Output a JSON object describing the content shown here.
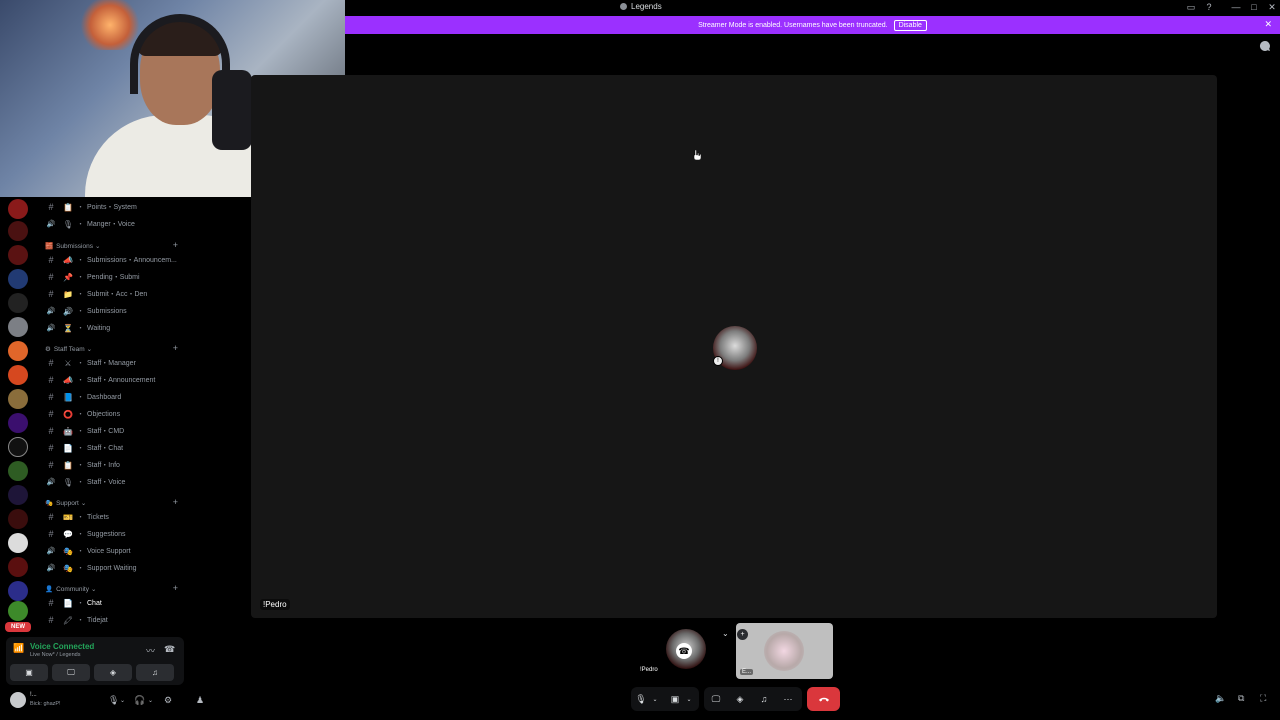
{
  "window": {
    "title": "Legends"
  },
  "banner": {
    "text": "Streamer Mode is enabled. Usernames have been truncated.",
    "disable_label": "Disable",
    "color": "#9b30ff"
  },
  "sidebar": {
    "channels": [
      {
        "type": "text",
        "emoji": "📋",
        "label": "Points・System",
        "y": 10
      },
      {
        "type": "voice",
        "emoji": "🎙",
        "label": "Manger・Voice",
        "y": 27
      }
    ],
    "categories": [
      {
        "name": "Submissions",
        "emoji": "🧱",
        "items": [
          {
            "type": "text",
            "emoji": "📣",
            "label": "Submissions・Announcem..."
          },
          {
            "type": "text",
            "emoji": "📌",
            "label": "Pending・Submi"
          },
          {
            "type": "text",
            "emoji": "📁",
            "label": "Submit・Acc・Den"
          },
          {
            "type": "voice",
            "emoji": "🔊",
            "label": "Submissions"
          },
          {
            "type": "voice",
            "emoji": "⏳",
            "label": "Waiting"
          }
        ]
      },
      {
        "name": "Staff Team",
        "emoji": "⚙",
        "items": [
          {
            "type": "text",
            "emoji": "⚔",
            "label": "Staff・Manager"
          },
          {
            "type": "text",
            "emoji": "📣",
            "label": "Staff・Announcement"
          },
          {
            "type": "text",
            "emoji": "📘",
            "label": "Dashboard"
          },
          {
            "type": "text",
            "emoji": "⭕",
            "label": "Objections"
          },
          {
            "type": "text",
            "emoji": "🤖",
            "label": "Staff・CMD"
          },
          {
            "type": "text",
            "emoji": "📄",
            "label": "Staff・Chat"
          },
          {
            "type": "text",
            "emoji": "📋",
            "label": "Staff・Info"
          },
          {
            "type": "voice",
            "emoji": "🎙",
            "label": "Staff・Voice"
          }
        ]
      },
      {
        "name": "Support",
        "emoji": "🎭",
        "items": [
          {
            "type": "text",
            "emoji": "🎫",
            "label": "Tickets"
          },
          {
            "type": "text",
            "emoji": "💬",
            "label": "Suggestions"
          },
          {
            "type": "voice",
            "emoji": "🎭",
            "label": "Voice Support"
          },
          {
            "type": "voice",
            "emoji": "🎭",
            "label": "Support Waiting"
          }
        ]
      },
      {
        "name": "Community",
        "emoji": "👤",
        "items": [
          {
            "type": "text",
            "emoji": "📄",
            "label": "Chat",
            "active": true
          },
          {
            "type": "text",
            "emoji": "🖍",
            "label": "Tidejat"
          }
        ]
      }
    ]
  },
  "servers": {
    "new_badge": "NEW"
  },
  "voice_panel": {
    "status": "Voice Connected",
    "subtitle": "Live Now* / Legends",
    "status_color": "#23a55a"
  },
  "user": {
    "name": "!...",
    "status": "Bick: ghazP!"
  },
  "stage": {
    "name_label": "!Pedro"
  },
  "tiles": [
    {
      "label": "!Pedro"
    },
    {
      "label": "E..."
    }
  ],
  "colors": {
    "end_call": "#da373c",
    "stage_bg": "#161616"
  }
}
